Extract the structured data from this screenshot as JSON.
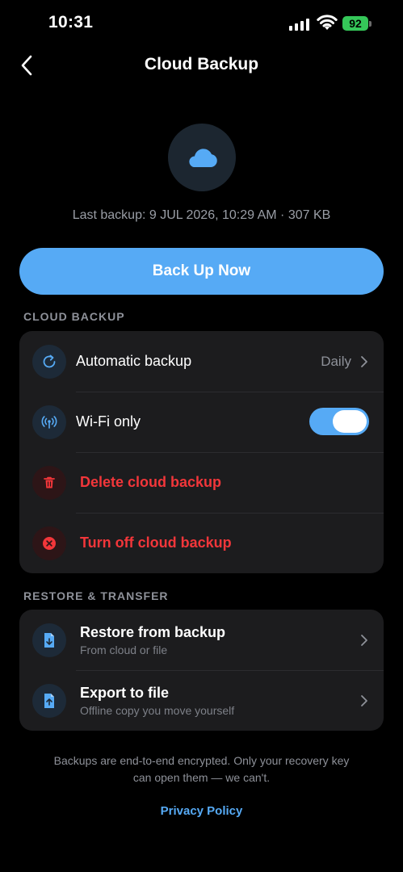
{
  "status_bar": {
    "time": "10:31",
    "battery": "92"
  },
  "header": {
    "title": "Cloud Backup"
  },
  "hero": {
    "last_backup": "Last backup: 9 JUL 2026, 10:29 AM · 307 KB"
  },
  "primary_button": {
    "label": "Back Up Now"
  },
  "cloud_section": {
    "heading": "CLOUD BACKUP",
    "automatic": {
      "label": "Automatic backup",
      "value": "Daily",
      "icon": "refresh-icon"
    },
    "wifi": {
      "label": "Wi-Fi only",
      "enabled": true,
      "icon": "antenna-icon"
    },
    "delete": {
      "label": "Delete cloud backup",
      "icon": "trash-icon"
    },
    "turn_off": {
      "label": "Turn off cloud backup",
      "icon": "x-circle-icon"
    }
  },
  "restore_section": {
    "heading": "RESTORE & TRANSFER",
    "restore": {
      "label": "Restore from backup",
      "sub": "From cloud or file",
      "icon": "file-download-icon"
    },
    "export": {
      "label": "Export to file",
      "sub": "Offline copy you move yourself",
      "icon": "file-upload-icon"
    }
  },
  "footer": {
    "line1": "Backups are end-to-end encrypted. Only your recovery key",
    "line2": "can open them — we can't.",
    "privacy_link": "Privacy Policy"
  },
  "colors": {
    "accent": "#56aaf5",
    "danger": "#f2363a",
    "card": "#1c1c1e",
    "toggle_on": "#56aaf5"
  }
}
